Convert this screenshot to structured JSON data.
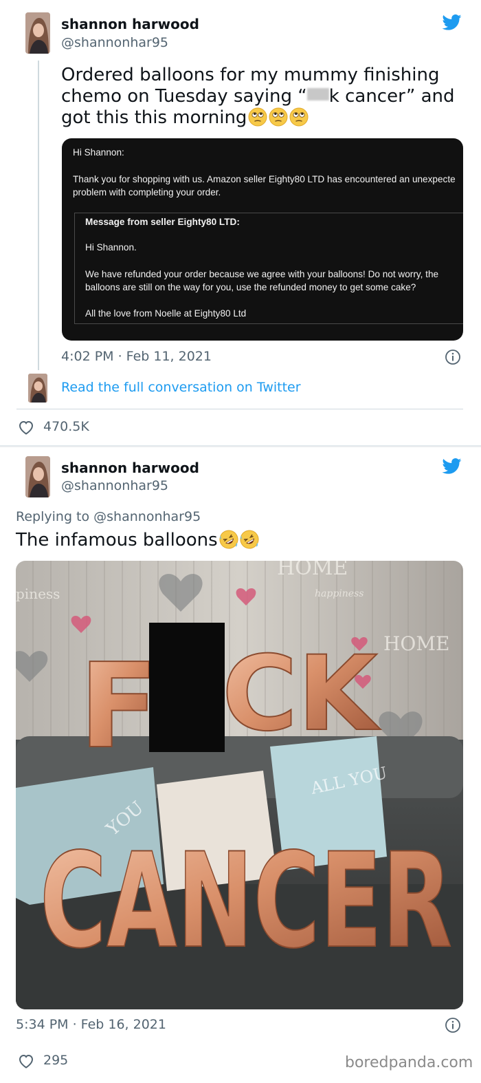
{
  "tweet1": {
    "author_name": "shannon harwood",
    "author_handle": "@shannonhar95",
    "text_line1": "Ordered balloons for my mummy finishing",
    "text_line2": "chemo on Tuesday saying “",
    "text_line2_after": "k cancer” and",
    "text_line3": "got this this morning",
    "emojis": [
      "face-with-rolling-eyes",
      "face-with-rolling-eyes",
      "face-with-rolling-eyes"
    ],
    "email": {
      "greeting": "Hi Shannon:",
      "body_line1": "Thank you for shopping with us. Amazon seller Eighty80 LTD has encountered an unexpecte",
      "body_line2": "problem with completing your order.",
      "quote_heading": "Message from seller Eighty80 LTD:",
      "quote_greeting": "Hi Shannon.",
      "quote_line1": "We have refunded your order because we agree with your balloons! Do not worry, the",
      "quote_line2": "balloons are still on the way for you, use the refunded money to get some cake?",
      "quote_signoff": "All the love from Noelle at Eighty80 Ltd"
    },
    "timestamp": "4:02 PM · Feb 11, 2021",
    "read_conversation_link": "Read the full conversation on Twitter",
    "like_count": "470.5K"
  },
  "tweet2": {
    "author_name": "shannon harwood",
    "author_handle": "@shannonhar95",
    "reply_context": "Replying to @shannonhar95",
    "text": "The infamous balloons",
    "emojis": [
      "rolling-on-the-floor-laughing",
      "rolling-on-the-floor-laughing"
    ],
    "photo_texts": {
      "wall_left": "piness",
      "wall_right": "happiness",
      "wall_top": "HOME",
      "wall_side": "HOME",
      "balloons_top_left": "F",
      "balloons_top_right": "CK",
      "balloons_bottom": "CANCER",
      "cushion_text_right": "ALL YOU",
      "cushion_text_left": "YOU"
    },
    "timestamp": "5:34 PM · Feb 16, 2021",
    "like_count": "295"
  },
  "watermark": "boredpanda.com",
  "colors": {
    "twitter_blue": "#1d9bf0",
    "secondary_text": "#536471",
    "email_bg": "#111111",
    "balloon_rose_gold": "#d9906a"
  }
}
